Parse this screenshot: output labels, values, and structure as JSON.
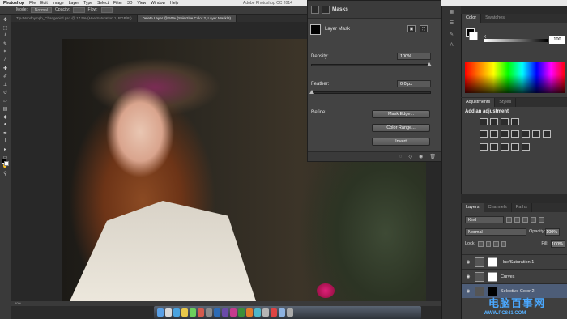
{
  "menubar": {
    "app": "Photoshop",
    "items": [
      "File",
      "Edit",
      "Image",
      "Layer",
      "Type",
      "Select",
      "Filter",
      "3D",
      "View",
      "Window",
      "Help"
    ],
    "title": "Adobe Photoshop CC 2014"
  },
  "options": {
    "mode_label": "Mode:",
    "mode_value": "Normal",
    "opacity_label": "Opacity:",
    "flow_label": "Flow:"
  },
  "tabs": [
    {
      "label": "Tip-Woodnymph_Changebird.psd @ 17.5% (Hue/Saturation 1, RGB/8*)",
      "active": false
    },
    {
      "label": "Delete Layer @ 50% (Selective Color 2, Layer Mask/8)",
      "active": true
    }
  ],
  "status": "50%",
  "masks_panel": {
    "title": "Masks",
    "layer_mask_label": "Layer Mask",
    "density_label": "Density:",
    "density_value": "100%",
    "feather_label": "Feather:",
    "feather_value": "0.0 px",
    "refine_label": "Refine:",
    "buttons": {
      "mask_edge": "Mask Edge...",
      "color_range": "Color Range...",
      "invert": "Invert"
    }
  },
  "color_panel": {
    "tabs": [
      "Color",
      "Swatches"
    ],
    "k_label": "K",
    "k_value": "100"
  },
  "adjustments_panel": {
    "tabs": [
      "Adjustments",
      "Styles"
    ],
    "title": "Add an adjustment"
  },
  "layers_panel": {
    "tabs": [
      "Layers",
      "Channels",
      "Paths"
    ],
    "kind_label": "Kind",
    "blend_mode": "Normal",
    "opacity_label": "Opacity:",
    "opacity_value": "100%",
    "lock_label": "Lock:",
    "fill_label": "Fill:",
    "fill_value": "100%",
    "layers": [
      {
        "name": "Hue/Saturation 1",
        "selected": false
      },
      {
        "name": "Curves",
        "selected": false
      },
      {
        "name": "Selective Color 2",
        "selected": true
      }
    ]
  },
  "watermark": {
    "cn": "电脑百事网",
    "url": "WWW.PC841.COM"
  },
  "colors": {
    "accent_selected": "#4d5d78",
    "panel_bg": "#434343",
    "workspace": "#282828"
  }
}
